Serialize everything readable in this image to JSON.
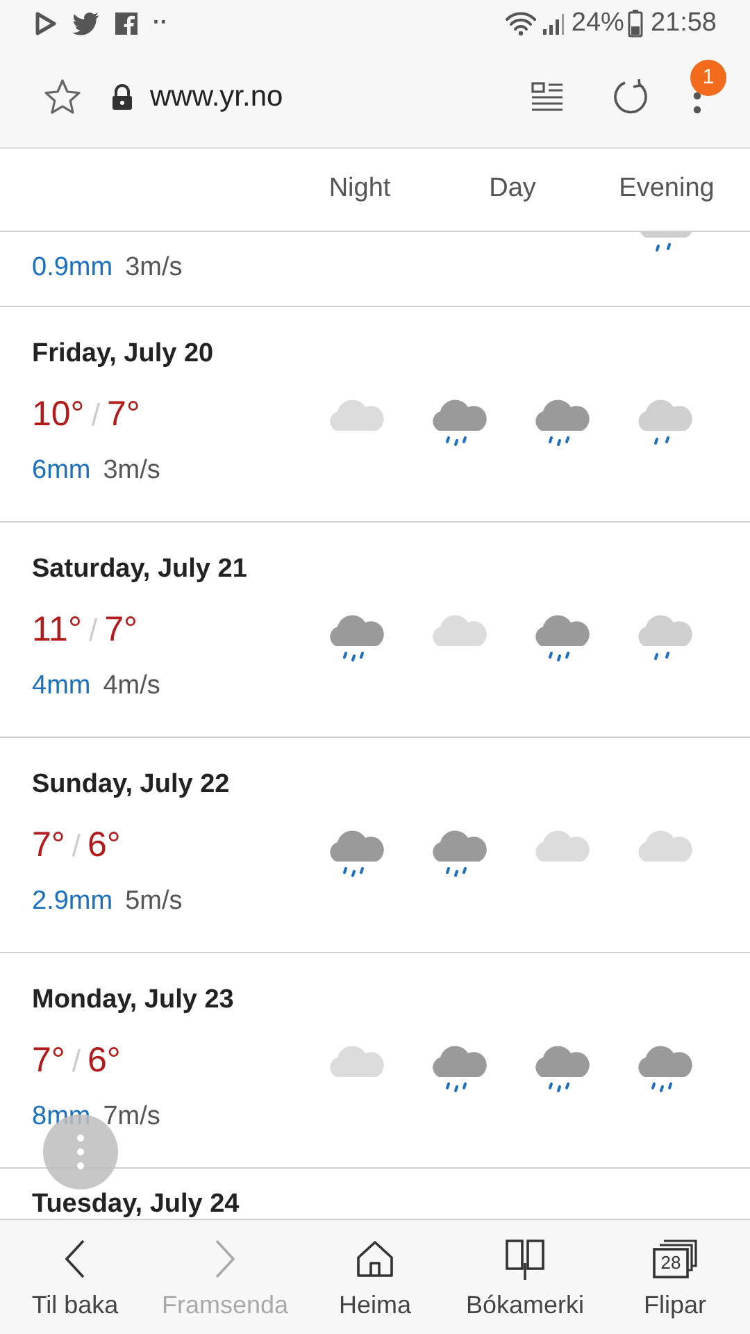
{
  "status_bar": {
    "more": "··",
    "battery": "24%",
    "time": "21:58"
  },
  "browser": {
    "url": "www.yr.no",
    "menu_badge": "1"
  },
  "columns": [
    "Night",
    "Day",
    "Evening"
  ],
  "partial_row": {
    "precipitation": "0.9mm",
    "wind": "3m/s",
    "last_symbol": {
      "kind": "light-rain"
    }
  },
  "days": [
    {
      "date": "Friday, July 20",
      "high": "10°",
      "divider": "/",
      "low": "7°",
      "precipitation": "6mm",
      "wind": "3m/s",
      "symbols": [
        {
          "kind": "cloud"
        },
        {
          "kind": "rain"
        },
        {
          "kind": "rain"
        },
        {
          "kind": "light-rain"
        }
      ]
    },
    {
      "date": "Saturday, July 21",
      "high": "11°",
      "divider": "/",
      "low": "7°",
      "precipitation": "4mm",
      "wind": "4m/s",
      "symbols": [
        {
          "kind": "rain"
        },
        {
          "kind": "cloud"
        },
        {
          "kind": "rain"
        },
        {
          "kind": "light-rain"
        }
      ]
    },
    {
      "date": "Sunday, July 22",
      "high": "7°",
      "divider": "/",
      "low": "6°",
      "precipitation": "2.9mm",
      "wind": "5m/s",
      "symbols": [
        {
          "kind": "rain"
        },
        {
          "kind": "rain"
        },
        {
          "kind": "cloud"
        },
        {
          "kind": "cloud"
        }
      ]
    },
    {
      "date": "Monday, July 23",
      "high": "7°",
      "divider": "/",
      "low": "6°",
      "precipitation": "8mm",
      "wind": "7m/s",
      "symbols": [
        {
          "kind": "cloud"
        },
        {
          "kind": "rain"
        },
        {
          "kind": "rain"
        },
        {
          "kind": "rain"
        }
      ]
    },
    {
      "date": "Tuesday, July 24"
    }
  ],
  "bottom_nav": [
    {
      "kind": "back",
      "label": "Til baka",
      "disabled": false
    },
    {
      "kind": "forward",
      "label": "Framsenda",
      "disabled": true
    },
    {
      "kind": "home",
      "label": "Heima",
      "disabled": false
    },
    {
      "kind": "bookmarks",
      "label": "Bókamerki",
      "disabled": false
    },
    {
      "kind": "tabs",
      "label": "Flipar",
      "disabled": false,
      "count": "28"
    }
  ]
}
